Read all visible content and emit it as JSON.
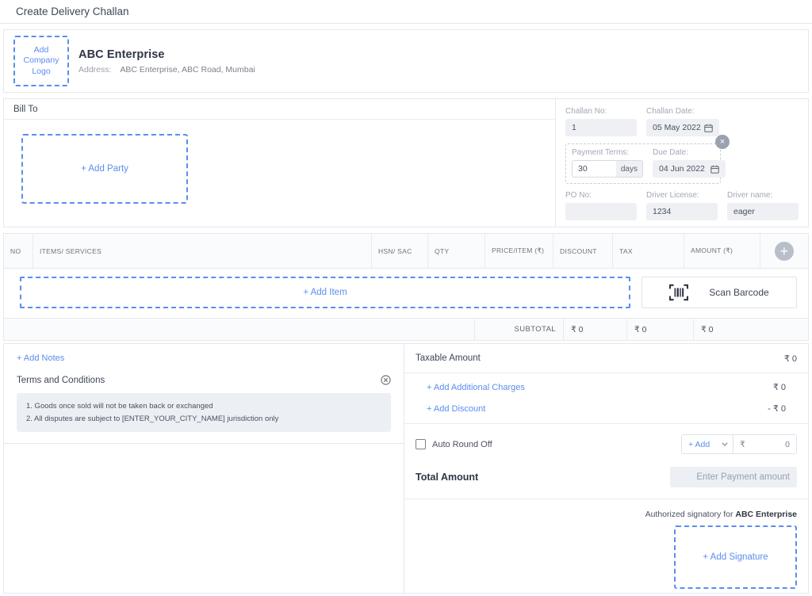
{
  "titlebar": {
    "title": "Create Delivery Challan"
  },
  "company": {
    "logo_placeholder": "Add Company Logo",
    "name": "ABC Enterprise",
    "address_label": "Address:",
    "address_value": "ABC Enterprise, ABC Road, Mumbai"
  },
  "bill_to": {
    "heading": "Bill To",
    "add_party_label": "+ Add Party"
  },
  "challan": {
    "challan_no_label": "Challan No:",
    "challan_no_value": "1",
    "challan_date_label": "Challan Date:",
    "challan_date_value": "05 May 2022",
    "payment_terms_label": "Payment Terms:",
    "payment_terms_value": "30",
    "payment_terms_unit": "days",
    "due_date_label": "Due Date:",
    "due_date_value": "04 Jun 2022",
    "po_no_label": "PO No:",
    "po_no_value": "",
    "driver_license_label": "Driver License:",
    "driver_license_value": "1234",
    "driver_name_label": "Driver name:",
    "driver_name_value": "eager"
  },
  "items_table": {
    "columns": {
      "no": "NO",
      "items": "ITEMS/ SERVICES",
      "hsn": "HSN/ SAC",
      "qty": "QTY",
      "price": "PRICE/ITEM (₹)",
      "discount": "DISCOUNT",
      "tax": "TAX",
      "amount": "AMOUNT (₹)"
    },
    "rows": [],
    "add_item_label": "+ Add Item",
    "scan_barcode_label": "Scan Barcode"
  },
  "subtotal": {
    "label": "SUBTOTAL",
    "cell1": "₹ 0",
    "cell2": "₹ 0",
    "cell3": "₹ 0"
  },
  "notes": {
    "add_notes_label": "+ Add Notes",
    "terms_title": "Terms and Conditions",
    "terms_line1": "1. Goods once sold will not be taken back or exchanged",
    "terms_line2": "2. All disputes are subject to [ENTER_YOUR_CITY_NAME] jurisdiction only"
  },
  "totals": {
    "taxable_amount_label": "Taxable Amount",
    "taxable_amount_value": "₹ 0",
    "additional_charges_label": "+ Add Additional Charges",
    "additional_charges_value": "₹ 0",
    "discount_label": "+ Add Discount",
    "discount_value": "- ₹ 0",
    "auto_round_off_label": "Auto Round Off",
    "round_select_value": "+ Add",
    "round_currency": "₹",
    "round_amount": "0",
    "total_amount_label": "Total Amount",
    "payment_placeholder": "Enter Payment amount"
  },
  "signature": {
    "authorized_prefix": "Authorized signatory for ",
    "company_name": "ABC Enterprise",
    "add_signature_label": "+ Add Signature"
  },
  "colors": {
    "accent_blue": "#5b8def",
    "text_dark": "#2f3545",
    "text_muted": "#9aa0ad",
    "border": "#e6e8ec",
    "field_bg": "#eef0f4"
  }
}
